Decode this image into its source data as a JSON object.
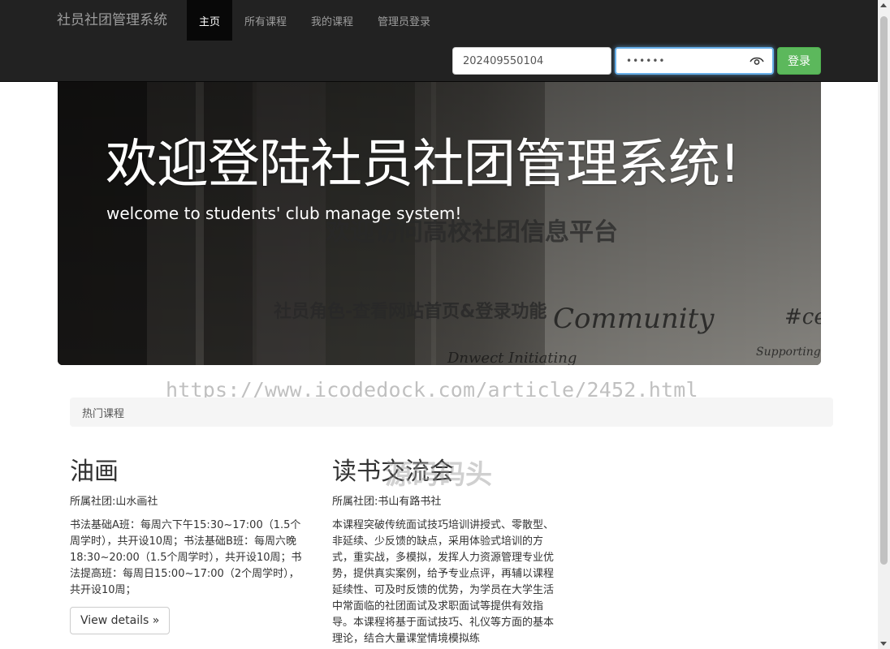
{
  "navbar": {
    "brand": "社员社团管理系统",
    "items": [
      {
        "label": "主页",
        "active": true
      },
      {
        "label": "所有课程",
        "active": false
      },
      {
        "label": "我的课程",
        "active": false
      },
      {
        "label": "管理员登录",
        "active": false
      }
    ],
    "login": {
      "username_value": "202409550104",
      "password_value": "••••••",
      "button_label": "登录"
    }
  },
  "jumbotron": {
    "title": "欢迎登陆社员社团管理系统!",
    "subtitle": "welcome to students' club manage system!",
    "image_text_1": "欢迎访问高校社团信息平台",
    "image_text_2": "社员角色-查看网站首页&登录功能",
    "image_handwriting": "Community",
    "image_handwriting_2": "Dnwect   Initiating",
    "image_handwriting_3": "Supporting",
    "image_handwriting_4": "#ce"
  },
  "watermark": {
    "url": "https://www.icodedock.com/article/2452.html",
    "brand": "源码码头"
  },
  "breadcrumb": {
    "label": "热门课程"
  },
  "courses": [
    {
      "title": "油画",
      "club": "所属社团:山水画社",
      "description": "书法基础A班：每周六下午15:30~17:00（1.5个周学时），共开设10周；书法基础B班：每周六晚18:30~20:00（1.5个周学时），共开设10周；书法提高班：每周日15:00~17:00（2个周学时），共开设10周；",
      "button_label": "View details »"
    },
    {
      "title": "读书交流会",
      "club": "所属社团:书山有路书社",
      "description": "本课程突破传统面试技巧培训讲授式、零散型、非延续、少反馈的缺点，采用体验式培训的方式，重实战，多模拟，发挥人力资源管理专业优势，提供真实案例，给予专业点评，再辅以课程延续性、可及时反馈的优势，为学员在大学生活中常面临的社团面试及求职面试等提供有效指导。本课程将基于面试技巧、礼仪等方面的基本理论，结合大量课堂情境模拟练"
    }
  ],
  "colors": {
    "navbar_bg": "#222222",
    "nav_active_bg": "#080808",
    "login_button": "#5cb85c",
    "focus_border": "#66afe9"
  }
}
